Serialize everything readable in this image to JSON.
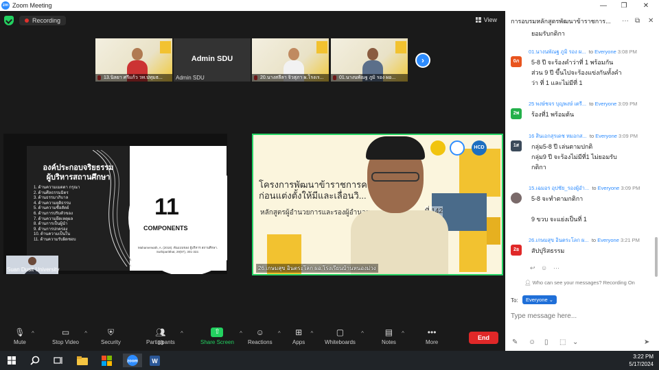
{
  "window": {
    "title": "Zoom Meeting",
    "logo": "zm"
  },
  "meeting": {
    "recording_label": "Recording",
    "view_label": "View"
  },
  "thumbnails": [
    {
      "label": "13.นิลยา ศรีแก้ว วท.ปทุมธ..."
    },
    {
      "label": "Admin SDU",
      "name": "Admin SDU"
    },
    {
      "label": "20.นางสลีลา จิวสุภา ผ.โรงเร..."
    },
    {
      "label": "01.นางนพัณฐ ภูมิ รอง ผอ..."
    }
  ],
  "slide": {
    "title_line1": "องค์ประกอบจริยธรรม",
    "title_line2": "ผู้บริหารสถานศึกษา",
    "items": [
      "1. ด้านความเมตตา กรุณา",
      "2. ด้านศีลธรรมมิตร",
      "3. ด้านธรรมาภิบาล",
      "4. ด้านความยุติธรรม",
      "5. ด้านความซื่อสัตย์",
      "6. ด้านการปรับตัวของ",
      "7. ด้านความยึดเหตุผล",
      "8. ด้านการเป็นผู้นำ",
      "9. ด้านการปกครอง",
      "10. ด้านความเป็นใน",
      "11. ด้านความรับผิดชอบ"
    ],
    "number": "11",
    "components": "COMPONENTS",
    "citation": "Mahamerwath, A. (2018). ต้นแบบของ ผู้บริหาร สถานศึกษา. Suthiparitthat, 29(97), 301-322."
  },
  "tiles": {
    "presenter_label": "Suan Dusit University",
    "speaker_label": "26.เกษมสุข อินตระโลก ผอ.โรงเรียนบ้านหนองม่วง"
  },
  "speaker_slide": {
    "title_line1": "โครงการพัฒนาข้าราชการค...                 ...ศึกษา",
    "title_line2": "ก่อนแต่งตั้งให้มีและเลื่อนวิ...",
    "subtitle": "หลักสูตรผู้อำนวยการและรองผู้อำนวย...",
    "number_fragment": "ที่ 142",
    "badge": "HCD"
  },
  "toolbar": {
    "mute": "Mute",
    "stop_video": "Stop Video",
    "security": "Security",
    "participants": "Participants",
    "participants_count": "33",
    "share_screen": "Share Screen",
    "reactions": "Reactions",
    "apps": "Apps",
    "whiteboards": "Whiteboards",
    "notes": "Notes",
    "more": "More",
    "end": "End"
  },
  "chat": {
    "title": "การอบรมหลักสูตรพัฒนาข้าราชการ...",
    "top_fragment": "ยอมรับกติกา",
    "messages": [
      {
        "avatar": "0ภ",
        "color": "#e8541e",
        "sender": "01.นางนพัณฐ ภูมิ รอง ผ...",
        "to": "to",
        "recipient": "Everyone",
        "time": "3:08 PM",
        "text": "5-8 ปี จะร้องคำว่าที่ 1 พร้อมกัน\nส่วน 9 ปี ขึ้นไปจะร้องแข่งกันทั้งคำ\nว่า ที่ 1 และไม่มีที่ 1"
      },
      {
        "avatar": "2พ",
        "color": "#23b04a",
        "sender": "25 พงษ์ชจร บุญพงษ์ เตรี...",
        "to": "to",
        "recipient": "Everyone",
        "time": "3:09 PM",
        "text": "ร้องที่1 พร้อมต้น"
      },
      {
        "avatar": "1ส",
        "color": "#3b4a5a",
        "sender": "16 สินเอกสุรเดช หมอกส...",
        "to": "to",
        "recipient": "Everyone",
        "time": "3:09 PM",
        "text": "กลุ่ม5-8 ปี เล่นตามปกติ\nกลุ่ม9 ปี จะร้องไม่มีที่1 ไม่ยอมรับ\nกติกา"
      },
      {
        "avatar": "",
        "color": "#7a6a6a",
        "sender": "15.เฉมอร อุปชัย_รองผู้อำ...",
        "to": "to",
        "recipient": "Everyone",
        "time": "3:09 PM",
        "text": "5-8 จะทำตามกติกา\n\n9 ขวบ จะแย่งเป็นที่ 1"
      },
      {
        "avatar": "2อ",
        "color": "#e02828",
        "sender": "26.เกษมสุข อินตระโลก ผ...",
        "to": "to",
        "recipient": "Everyone",
        "time": "3:21 PM",
        "text": "สัปปุริสธรรม"
      }
    ],
    "who_can_see": "Who can see your messages? Recording On",
    "to_label": "To:",
    "to_value": "Everyone",
    "input_placeholder": "Type message here..."
  },
  "taskbar": {
    "time": "3:22 PM",
    "date": "5/17/2024"
  },
  "colors": {
    "zoom_blue": "#2D8CFF",
    "active_speaker": "#26d466",
    "end_red": "#e02828",
    "share_green": "#23d160"
  }
}
